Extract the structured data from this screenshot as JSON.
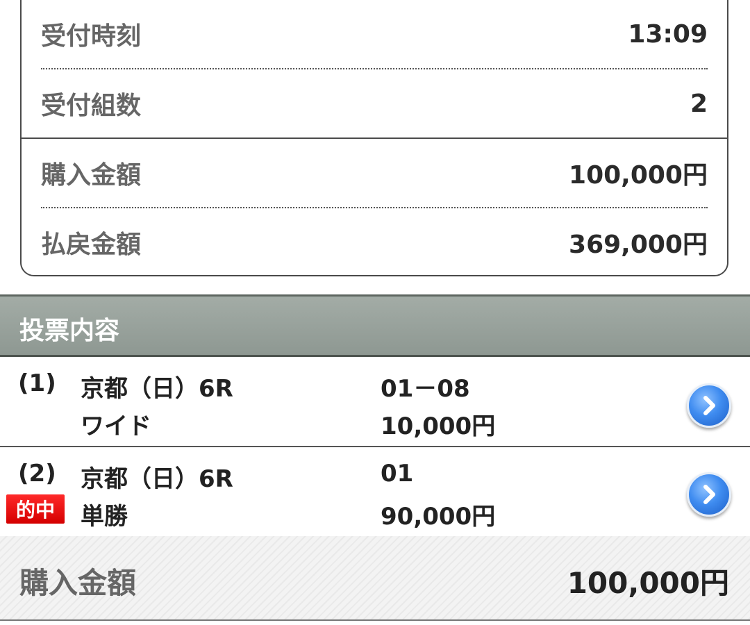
{
  "summary": {
    "rows": [
      {
        "label": "受付時刻",
        "value": "13:09"
      },
      {
        "label": "受付組数",
        "value": "2"
      },
      {
        "label": "購入金額",
        "value": "100,000円"
      },
      {
        "label": "払戻金額",
        "value": "369,000円"
      }
    ]
  },
  "section": {
    "title": "投票内容"
  },
  "bets": [
    {
      "number": "(1)",
      "race": "京都（日）6R",
      "type": "ワイド",
      "combination": "01－08",
      "amount": "10,000円",
      "hit": false
    },
    {
      "number": "(2)",
      "race": "京都（日）6R",
      "type": "単勝",
      "combination": "01",
      "amount": "90,000円",
      "hit": true,
      "hit_label": "的中"
    }
  ],
  "total": {
    "label": "購入金額",
    "value": "100,000円"
  },
  "icons": {
    "detail": "chevron-right-circle-icon"
  },
  "colors": {
    "header_bg": "#97a09a",
    "hit_badge": "#e00000",
    "arrow_button": "#3f8cf0"
  }
}
